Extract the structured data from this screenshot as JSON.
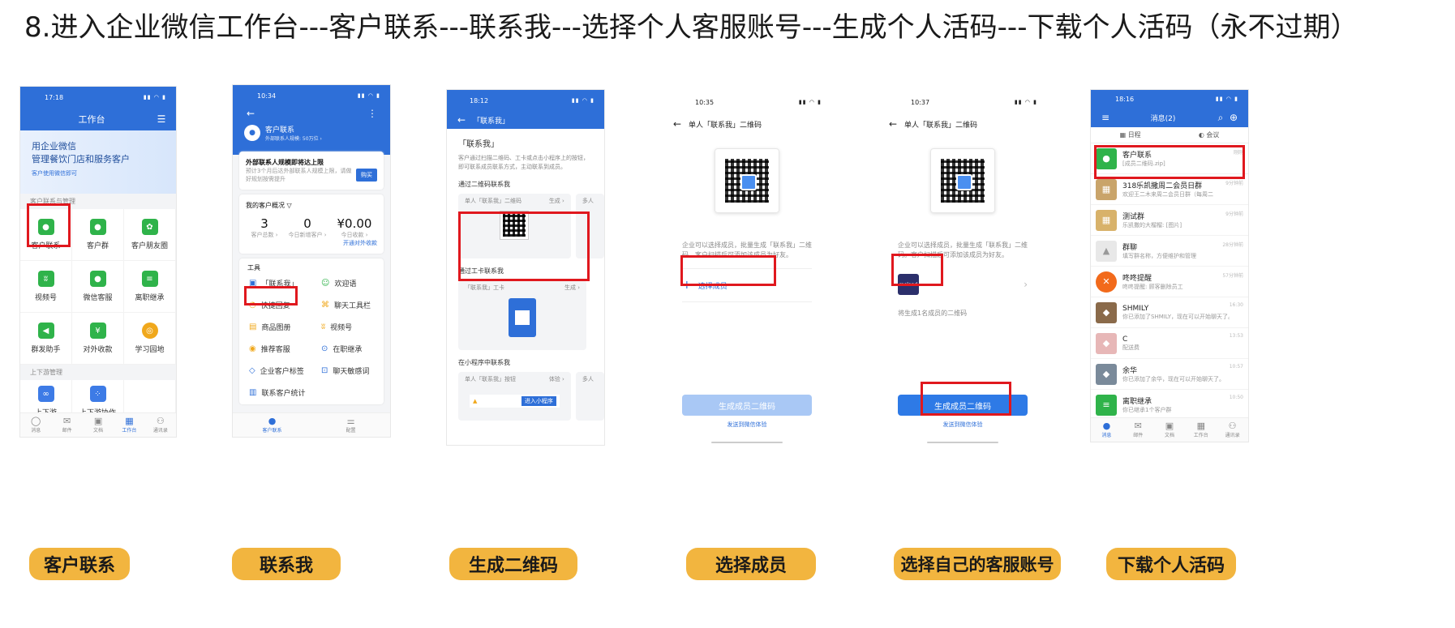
{
  "heading": "8.进入企业微信工作台---客户联系---联系我---选择个人客服账号---生成个人活码---下载个人活码（永不过期）",
  "labels": [
    "客户联系",
    "联系我",
    "生成二维码",
    "选择成员",
    "选择自己的客服账号",
    "下载个人活码"
  ],
  "accent": "#2e6fd8",
  "highlight": "#e0181e",
  "pill_color": "#f2b53f",
  "phone1": {
    "time": "17:18",
    "title": "工作台",
    "banner_line1": "用企业微信",
    "banner_line2": "管理餐饮门店和服务客户",
    "banner_note": "客户使用微信即可",
    "section1": "客户联系与管理",
    "apps": [
      "客户联系",
      "客户群",
      "客户朋友圈",
      "视频号",
      "微信客服",
      "离职继承",
      "群发助手",
      "对外收款",
      "学习园地"
    ],
    "section2": "上下游管理",
    "apps2": [
      "上下游",
      "上下游协作"
    ],
    "tabs": [
      "消息",
      "邮件",
      "文档",
      "工作台",
      "通讯录"
    ]
  },
  "phone2": {
    "time": "10:34",
    "name": "客户联系",
    "sub": "外部联系人规模: 50万位 ›",
    "notice_title": "外部联系人规模即将达上限",
    "notice_text": "预计3个月后达外部联系人规模上限，请做好规划按需提升",
    "buy": "购买",
    "overview": "我的客户概况",
    "stats": [
      {
        "n": "3",
        "l": "客户总数 ›"
      },
      {
        "n": "0",
        "l": "今日新增客户 ›"
      },
      {
        "n": "¥0.00",
        "l": "今日收款 ›"
      }
    ],
    "open_pay": "开通对外收款",
    "tools_title": "工具",
    "tools": [
      "「联系我」",
      "欢迎语",
      "快捷回复",
      "聊天工具栏",
      "商品图册",
      "视频号",
      "推荐客服",
      "在职继承",
      "企业客户标签",
      "聊天敏感词",
      "联系客户统计"
    ],
    "tabs": [
      "客户联系",
      "配置"
    ]
  },
  "phone3": {
    "time": "18:12",
    "title": "「联系我」",
    "head": "「联系我」",
    "desc": "客户通过扫描二维码、工卡或点击小程序上的按钮，即可联系成员联系方式，主动联系到成员。",
    "s1": "通过二维码联系我",
    "card1": "单人「联系我」二维码",
    "gen": "生成 ›",
    "multi": "多人",
    "s2": "通过工卡联系我",
    "card2": "「联系我」工卡",
    "s3": "在小程序中联系我",
    "card3": "单人「联系我」按钮",
    "trial": "体验 ›",
    "mini": "进入小程序"
  },
  "phone4": {
    "time": "10:35",
    "title": "单人「联系我」二维码",
    "desc": "企业可以选择成员，批量生成「联系我」二维码。客户扫描后可添加该成员为好友。",
    "select": "选择成员",
    "btn": "生成成员二维码",
    "link": "发送到微信体验"
  },
  "phone5": {
    "time": "10:37",
    "title": "单人「联系我」二维码",
    "desc": "企业可以选择成员，批量生成「联系我」二维码。客户扫描后可添加该成员为好友。",
    "member": "meland",
    "note": "将生成1名成员的二维码",
    "btn": "生成成员二维码",
    "link": "发送到微信体验"
  },
  "phone6": {
    "time": "18:16",
    "title": "消息(2)",
    "t1": "日程",
    "t2": "会议",
    "msgs": [
      {
        "name": "客户联系",
        "prev": "[成员二维码.zip]",
        "time": "刚刚"
      },
      {
        "name": "318乐凯撒周二会员日群",
        "prev": "欢迎王二木来周二会员日群（每周二",
        "time": "9分钟前"
      },
      {
        "name": "测试群",
        "prev": "乐凯撒的大榴榴: [图片]",
        "time": "9分钟前"
      },
      {
        "name": "群聊",
        "prev": "填写群名称，方便维护和管理",
        "time": "28分钟前"
      },
      {
        "name": "咚咚提醒",
        "prev": "咚咚提醒: 顾客删除员工",
        "time": "57分钟前"
      },
      {
        "name": "SHMILY",
        "prev": "你已添加了SHMILY，现在可以开始聊天了。",
        "time": "16:30"
      },
      {
        "name": "C",
        "prev": "配送费",
        "time": "13:53"
      },
      {
        "name": "余华",
        "prev": "你已添加了余华，现在可以开始聊天了。",
        "time": "10:57"
      },
      {
        "name": "离职继承",
        "prev": "你已继承1个客户群",
        "time": "10:50"
      }
    ],
    "tabs": [
      "消息",
      "邮件",
      "文档",
      "工作台",
      "通讯录"
    ]
  }
}
